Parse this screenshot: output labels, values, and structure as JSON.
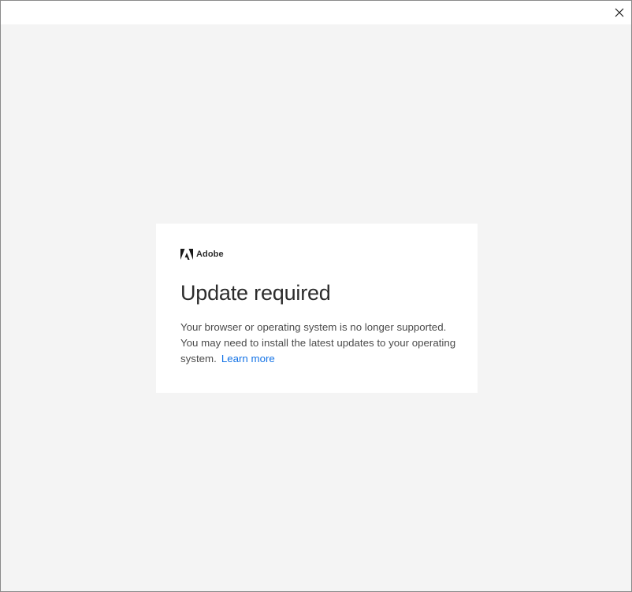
{
  "window": {
    "close_icon": "close-icon"
  },
  "card": {
    "brand": {
      "logo_icon": "adobe-logo-icon",
      "name": "Adobe"
    },
    "title": "Update required",
    "message_line1": "Your browser or operating system is no longer supported.",
    "message_line2": "You may need to install the latest updates to your operating",
    "message_line3": "system.",
    "link_label": "Learn more"
  },
  "colors": {
    "background": "#f4f4f4",
    "card": "#ffffff",
    "link": "#1473e6",
    "heading": "#2c2c2c",
    "body": "#4b4b4b"
  }
}
